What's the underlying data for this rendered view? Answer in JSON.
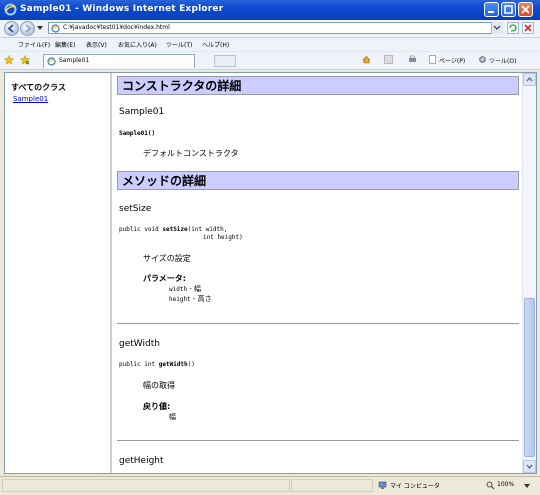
{
  "window": {
    "title": "Sample01 - Windows Internet Explorer"
  },
  "address": {
    "url": "C:¥javadoc¥test01¥doc¥index.html"
  },
  "menu": [
    {
      "label": "ファイル(F)"
    },
    {
      "label": "編集(E)"
    },
    {
      "label": "表示(V)"
    },
    {
      "label": "お気に入り(A)"
    },
    {
      "label": "ツール(T)"
    },
    {
      "label": "ヘルプ(H)"
    }
  ],
  "tab": {
    "label": "Sample01"
  },
  "commands": {
    "page": "ページ(P)",
    "tools": "ツール(O)"
  },
  "left": {
    "title": "すべてのクラス",
    "link": "Sample01"
  },
  "doc": {
    "constructor_heading": "コンストラクタの詳細",
    "constructor_name": "Sample01",
    "constructor_sig": "Sample01()",
    "constructor_desc": "デフォルトコンストラクタ",
    "method_heading": "メソッドの詳細",
    "m1": {
      "name": "setSize",
      "sig_prefix": "public void ",
      "sig_name": "setSize",
      "sig_line1": "(int width,",
      "sig_line2": "int height)",
      "desc": "サイズの設定",
      "params_label": "パラメータ:",
      "p1_name": "width",
      "p1_desc": " - 幅",
      "p2_name": "height",
      "p2_desc": " - 高さ"
    },
    "m2": {
      "name": "getWidth",
      "sig_prefix": "public int ",
      "sig_name": "getWidth",
      "sig_suffix": "()",
      "desc": "幅の取得",
      "returns_label": "戻り値:",
      "returns_desc": "幅"
    },
    "m3": {
      "name": "getHeight"
    }
  },
  "status": {
    "zone": "マイ コンピュータ",
    "zoom": "100%"
  }
}
